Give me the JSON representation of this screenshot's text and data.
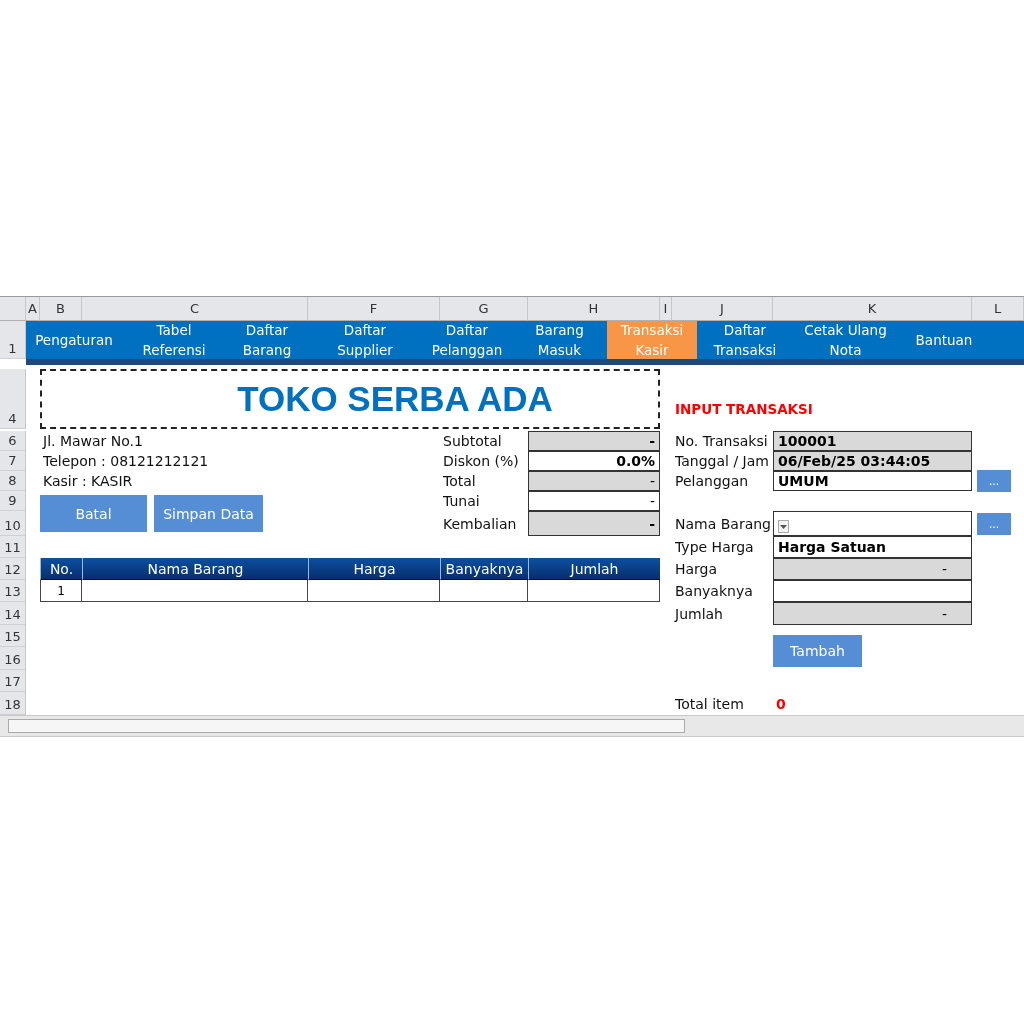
{
  "column_headers": [
    "A",
    "B",
    "C",
    "F",
    "G",
    "H",
    "I",
    "J",
    "K",
    "L"
  ],
  "row_numbers": [
    "1",
    "4",
    "6",
    "7",
    "8",
    "9",
    "10",
    "11",
    "12",
    "13",
    "14",
    "15",
    "16",
    "17",
    "18"
  ],
  "menu": [
    {
      "label": "Pengaturan",
      "selected": false
    },
    {
      "label": "Tabel\nReferensi",
      "selected": false
    },
    {
      "label": "Daftar\nBarang",
      "selected": false
    },
    {
      "label": "Daftar\nSupplier",
      "selected": false
    },
    {
      "label": "Daftar\nPelanggan",
      "selected": false
    },
    {
      "label": "Barang\nMasuk",
      "selected": false
    },
    {
      "label": "Transaksi\nKasir",
      "selected": true
    },
    {
      "label": "Daftar\nTransaksi",
      "selected": false
    },
    {
      "label": "Cetak Ulang\nNota",
      "selected": false
    },
    {
      "label": "Bantuan",
      "selected": false
    }
  ],
  "shop": {
    "title": "TOKO SERBA ADA",
    "lines": [
      "Jl. Mawar No.1",
      "Telepon : 08121212121",
      "Kasir : KASIR"
    ]
  },
  "buttons": [
    "Batal",
    "Simpan Data"
  ],
  "summary": [
    {
      "label": "Subtotal",
      "value": "-",
      "readonly": true,
      "bold": true
    },
    {
      "label": "Diskon (%)",
      "value": "0.0%",
      "readonly": false,
      "bold": true
    },
    {
      "label": "Total",
      "value": "-",
      "readonly": true,
      "bold": false
    },
    {
      "label": "Tunai",
      "value": "-",
      "readonly": false,
      "bold": false
    },
    {
      "label": "Kembalian",
      "value": "-",
      "readonly": true,
      "bold": true
    }
  ],
  "table": {
    "columns": [
      "No.",
      "Nama Barang",
      "Harga",
      "Banyaknya",
      "Jumlah"
    ],
    "rows": [
      {
        "no": "1"
      }
    ]
  },
  "input": {
    "title": "INPUT TRANSAKSI",
    "fields": [
      {
        "label": "No. Transaksi",
        "value": "100001",
        "readonly": true,
        "kind": "text"
      },
      {
        "label": "Tanggal / Jam",
        "value": "06/Feb/25 03:44:05",
        "readonly": true,
        "kind": "text"
      },
      {
        "label": "Pelanggan",
        "value": "UMUM",
        "readonly": false,
        "kind": "lookup",
        "button": "..."
      },
      {
        "label": "Nama Barang",
        "readonly": false,
        "kind": "dropdown",
        "button": "..."
      },
      {
        "label": "Type Harga",
        "value": "Harga Satuan",
        "readonly": false,
        "kind": "text"
      },
      {
        "label": "Harga",
        "value": "-",
        "readonly": true,
        "kind": "number"
      },
      {
        "label": "Banyaknya",
        "readonly": false,
        "kind": "number"
      },
      {
        "label": "Jumlah",
        "value": "-",
        "readonly": true,
        "kind": "number"
      }
    ],
    "add_button": "Tambah",
    "total_label": "Total item",
    "total_value": "0"
  }
}
